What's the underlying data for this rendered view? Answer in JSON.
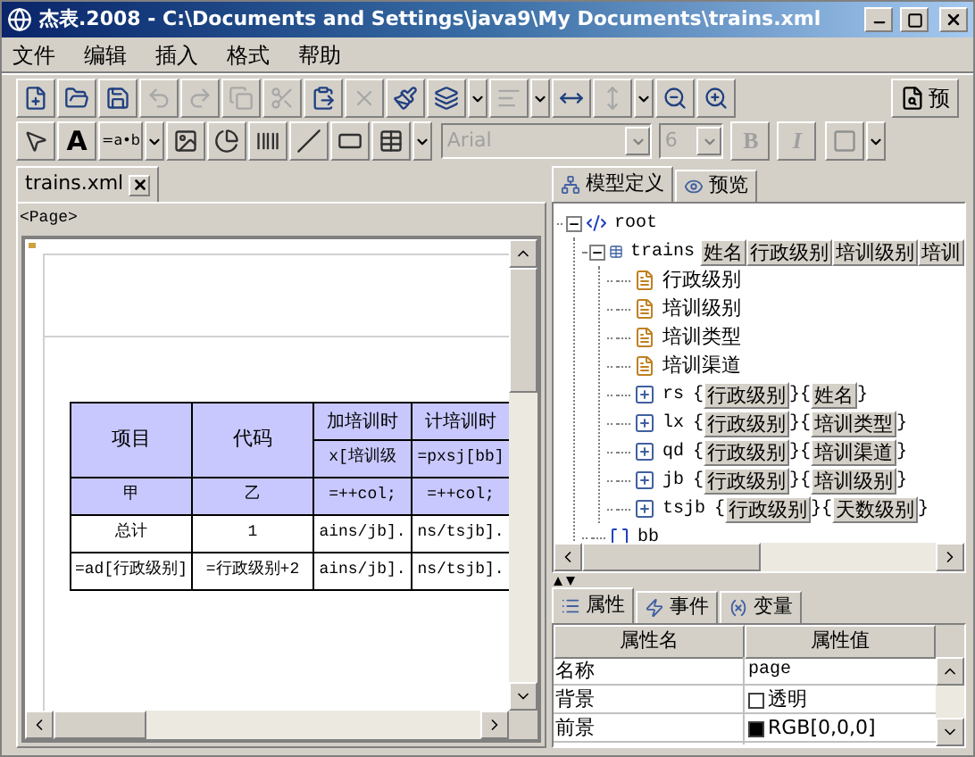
{
  "window": {
    "title": "杰表.2008 - C:\\Documents and Settings\\java9\\My Documents\\trains.xml"
  },
  "menu": [
    "文件",
    "编辑",
    "插入",
    "格式",
    "帮助"
  ],
  "toolbar_main": [
    {
      "disabled": false
    },
    {
      "disabled": false
    },
    {
      "disabled": false
    },
    {
      "disabled": true
    },
    {
      "disabled": true
    },
    {
      "disabled": true
    },
    {
      "disabled": true
    },
    {
      "disabled": false
    },
    {
      "disabled": true
    },
    {
      "disabled": false
    },
    {
      "disabled": false,
      "dropdown": true
    },
    {
      "disabled": true,
      "dropdown": true
    },
    {
      "disabled": false
    },
    {
      "disabled": true,
      "dropdown": true
    },
    {
      "disabled": false
    },
    {
      "disabled": false
    }
  ],
  "preview_button": {
    "label": "预"
  },
  "toolbar_format": {
    "tools": [
      {
        "kind": "pointer"
      },
      {
        "kind": "text",
        "label": "A"
      },
      {
        "kind": "text",
        "label": "=a•b",
        "dropdown": true
      },
      {
        "kind": "image"
      },
      {
        "kind": "chart"
      },
      {
        "kind": "barcode"
      },
      {
        "kind": "line"
      },
      {
        "kind": "frame"
      },
      {
        "kind": "table",
        "dropdown": true
      }
    ],
    "font": {
      "value": "Arial",
      "disabled": true
    },
    "size": {
      "value": "6",
      "disabled": true
    },
    "style_buttons": [
      {
        "label": "B",
        "disabled": true
      },
      {
        "label": "I",
        "disabled": true
      }
    ],
    "border": {
      "dropdown": true
    }
  },
  "document_tabs": [
    {
      "label": "trains.xml",
      "selected": true
    }
  ],
  "page_label": "<Page>",
  "report_table": {
    "header": [
      "项目",
      "代码",
      "加培训时",
      "计培训时"
    ],
    "header_sub": [
      "x[培训级",
      "=pxsj[bb]"
    ],
    "rows": [
      {
        "highlight": true,
        "cells": [
          "甲",
          "乙",
          "=++col;",
          "=++col;"
        ]
      },
      {
        "highlight": false,
        "cells": [
          "总计",
          "1",
          "ains/jb].",
          "ns/tsjb]."
        ]
      },
      {
        "highlight": false,
        "cells": [
          "=ad[行政级别]",
          "=行政级别+2",
          "ains/jb].",
          "ns/tsjb]."
        ]
      }
    ]
  },
  "side_tabs": [
    {
      "label": "模型定义",
      "selected": true
    },
    {
      "label": "预览",
      "selected": false
    }
  ],
  "tree": [
    {
      "kind": "element",
      "label": "root",
      "expanded": true,
      "children": [
        {
          "kind": "table",
          "label": "trains",
          "expanded": true,
          "keys": [
            "姓名",
            "行政级别",
            "培训级别",
            "培训"
          ],
          "children": [
            {
              "kind": "field",
              "label": "行政级别"
            },
            {
              "kind": "field",
              "label": "培训级别"
            },
            {
              "kind": "field",
              "label": "培训类型"
            },
            {
              "kind": "field",
              "label": "培训渠道"
            },
            {
              "kind": "relation",
              "label": "rs",
              "open": "{",
              "keys": [
                "行政级别",
                "姓名"
              ],
              "joiner": "}{",
              "close": "}"
            },
            {
              "kind": "relation",
              "label": "lx",
              "open": "{",
              "keys": [
                "行政级别",
                "培训类型"
              ],
              "joiner": "}{",
              "close": "}"
            },
            {
              "kind": "relation",
              "label": "qd",
              "open": "{",
              "keys": [
                "行政级别",
                "培训渠道"
              ],
              "joiner": "}{",
              "close": "}"
            },
            {
              "kind": "relation",
              "label": "jb",
              "open": "{",
              "keys": [
                "行政级别",
                "培训级别"
              ],
              "joiner": "}{",
              "close": "}"
            },
            {
              "kind": "relation",
              "label": "tsjb",
              "open": "{",
              "keys": [
                "行政级别",
                "天数级别"
              ],
              "joiner": "}{",
              "close": "}"
            }
          ]
        },
        {
          "kind": "array",
          "label": "bb"
        }
      ]
    }
  ],
  "bottom_tabs": [
    {
      "label": "属性",
      "selected": true
    },
    {
      "label": "事件",
      "selected": false
    },
    {
      "label": "变量",
      "selected": false
    }
  ],
  "properties": {
    "columns": [
      "属性名",
      "属性值"
    ],
    "rows": [
      {
        "name": "名称",
        "value": "page"
      },
      {
        "name": "背景",
        "value": "透明",
        "color": "#ffffff"
      },
      {
        "name": "前景",
        "value": "RGB[0,0,0]",
        "color": "#000000"
      }
    ]
  }
}
